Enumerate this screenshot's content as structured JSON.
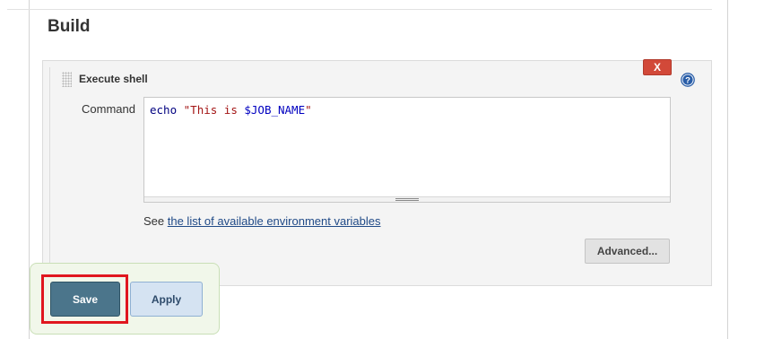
{
  "section": {
    "title": "Build"
  },
  "build_step": {
    "title": "Execute shell",
    "delete_label": "X",
    "command_label": "Command",
    "command": {
      "cmd": "echo",
      "space": " ",
      "string_open": "\"This is ",
      "variable": "$JOB_NAME",
      "string_close": "\""
    },
    "hint_prefix": "See ",
    "hint_link": "the list of available environment variables",
    "advanced_label": "Advanced..."
  },
  "footer": {
    "save_label": "Save",
    "apply_label": "Apply"
  },
  "icons": {
    "help": "help-icon",
    "drag": "drag-handle-icon"
  },
  "colors": {
    "save_bg": "#4b758b",
    "apply_bg": "#d5e3f2",
    "delete_bg": "#d24939",
    "highlight": "#e0161f",
    "link": "#204a87"
  }
}
